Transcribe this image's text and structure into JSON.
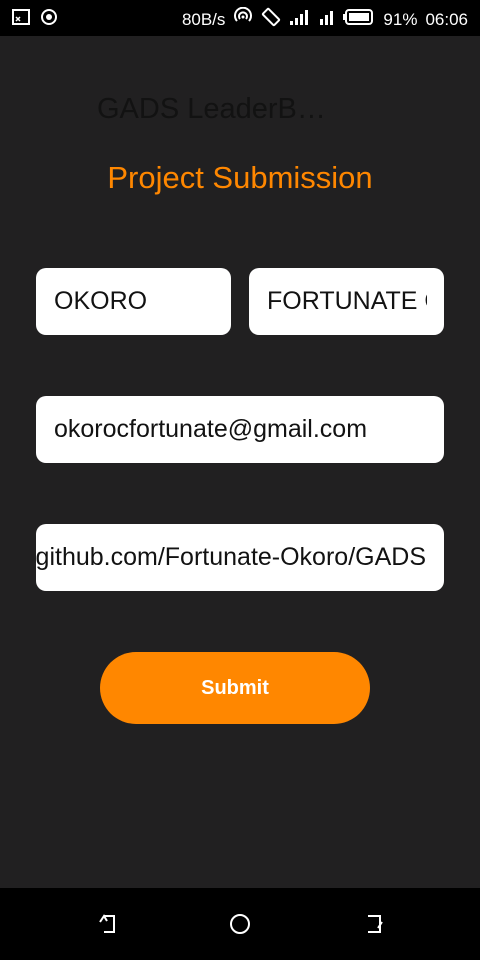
{
  "status_bar": {
    "speed": "80B/s",
    "battery": "91%",
    "time": "06:06",
    "icons": [
      "screen-cast-icon",
      "record-icon",
      "wifi-hotspot-icon",
      "rotate-icon",
      "signal-icon",
      "signal-4g-icon",
      "battery-icon"
    ]
  },
  "app": {
    "title": "GADS LeaderB…"
  },
  "page": {
    "title": "Project Submission"
  },
  "form": {
    "first_name": "OKORO",
    "last_name": "FORTUNATE OK",
    "email": "okorocfortunate@gmail.com",
    "link": "github.com/Fortunate-Okoro/GADS",
    "submit_label": "Submit"
  },
  "colors": {
    "accent": "#FF8700",
    "background": "#212021"
  },
  "nav": {
    "icons": [
      "back-icon",
      "home-icon",
      "recents-icon"
    ]
  }
}
